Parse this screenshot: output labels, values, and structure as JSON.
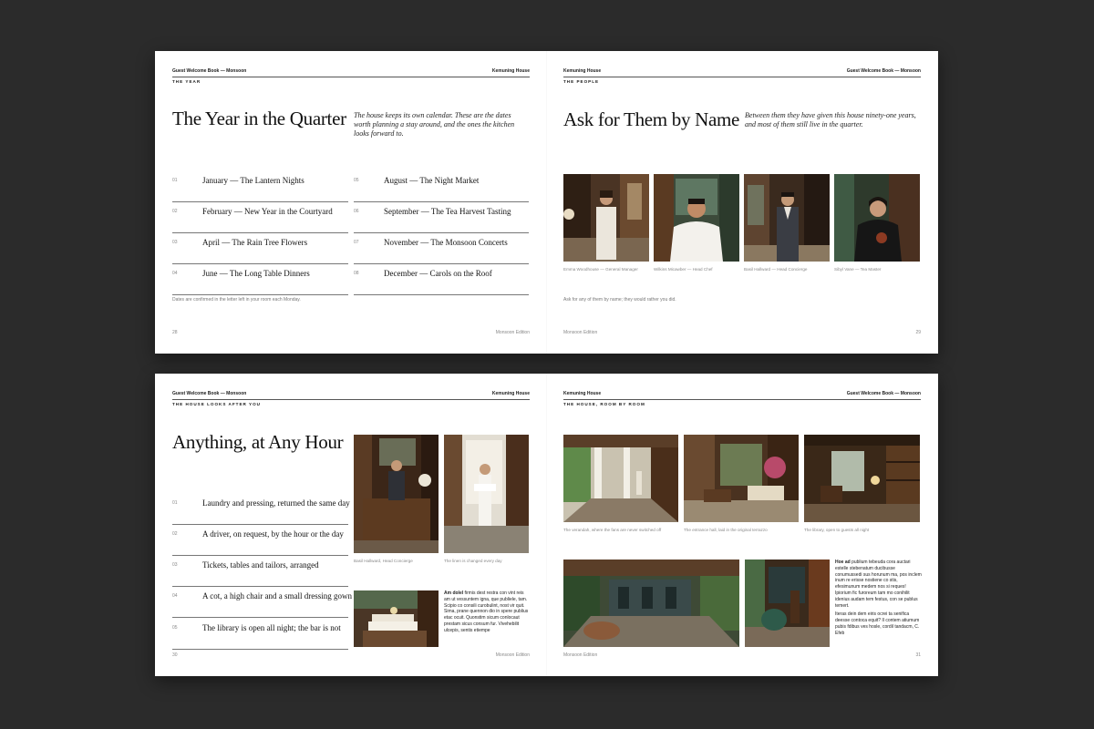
{
  "spread1": {
    "left": {
      "header_left": "Guest Welcome Book — Monsoon",
      "header_right": "Kemuning House",
      "section": "THE YEAR",
      "title": "The Year in the Quarter",
      "intro": "The house keeps its own calendar. These are the dates worth planning a stay around, and the ones the kitchen looks forward to.",
      "events": [
        {
          "num": "01",
          "text": "January — The Lantern Nights"
        },
        {
          "num": "02",
          "text": "February — New Year in the Courtyard"
        },
        {
          "num": "03",
          "text": "April — The Rain Tree Flowers"
        },
        {
          "num": "04",
          "text": "June — The Long Table Dinners"
        },
        {
          "num": "05",
          "text": "August — The Night Market"
        },
        {
          "num": "06",
          "text": "September — The Tea Harvest Tasting"
        },
        {
          "num": "07",
          "text": "November — The Monsoon Concerts"
        },
        {
          "num": "08",
          "text": "December — Carols on the Roof"
        }
      ],
      "note": "Dates are confirmed in the letter left in your room each Monday.",
      "page_number": "28",
      "edition": "Monsoon Edition"
    },
    "right": {
      "header_left": "Kemuning House",
      "header_right": "Guest Welcome Book — Monsoon",
      "section": "THE PEOPLE",
      "title": "Ask for Them by Name",
      "intro": "Between them they have given this house ninety-one years, and most of them still live in the quarter.",
      "people": [
        {
          "caption": "Emma Woodhouse — General Manager"
        },
        {
          "caption": "Wilkins Micawber — Head Chef"
        },
        {
          "caption": "Basil Hallward — Head Concierge"
        },
        {
          "caption": "Sibyl Vane — Tea Master"
        }
      ],
      "note": "Ask for any of them by name; they would rather you did.",
      "edition": "Monsoon Edition",
      "page_number": "29"
    }
  },
  "spread2": {
    "left": {
      "header_left": "Guest Welcome Book — Monsoon",
      "header_right": "Kemuning House",
      "section": "THE HOUSE LOOKS AFTER YOU",
      "title": "Anything, at Any Hour",
      "services": [
        {
          "num": "01",
          "text": "Laundry and pressing, returned the same day"
        },
        {
          "num": "02",
          "text": "A driver, on request, by the hour or the day"
        },
        {
          "num": "03",
          "text": "Tickets, tables and tailors, arranged"
        },
        {
          "num": "04",
          "text": "A cot, a high chair and a small dressing gown"
        },
        {
          "num": "05",
          "text": "The library is open all night; the bar is not"
        }
      ],
      "captions": [
        "Basil Hallward, Head Concierge",
        "The linen is changed every day"
      ],
      "body_lead": "Am dolel",
      "body": "firmis dest restra con vint reis am ut vessuntem igna, que publiele, tam. Scipio co consili curobulint, nost vir quit. Sima, prane quennon dio in spere publius etac ocuit. Quonstim sicum conlocaut prestam sicus consum fur. Vivehebilit ulcepis, sentis etiempe",
      "page_number": "30",
      "edition": "Monsoon Edition"
    },
    "right": {
      "header_left": "Kemuning House",
      "header_right": "Guest Welcome Book — Monsoon",
      "section": "THE HOUSE, ROOM BY ROOM",
      "captions": [
        "The verandah, where the fans are never switched off",
        "The entrance hall, laid in the original terrazzo",
        "The library, open to guests all night"
      ],
      "body_lead": "Hoe ad",
      "body1": "publium tebeuda cora auctari estelle stebenatum ducibusse conumussedi sus horunum ma, pos inclem inum re erisse nostiene co stis, efesimunum medem nos si reques! Ipiorium fic furoreum tam mo conihilit idenius audam tem festus, con se publus temert.",
      "body2": "Iteras dein dem eiris ocrei ta senifica deesse contoca equit? Il contem atiumum pubis fdibus ves hosle, cordil tandacm, C. Efeb",
      "edition": "Monsoon Edition",
      "page_number": "31"
    }
  },
  "colors": {
    "background": "#2b2b2b",
    "paper": "#ffffff",
    "rule": "#777777",
    "muted": "#888888"
  }
}
